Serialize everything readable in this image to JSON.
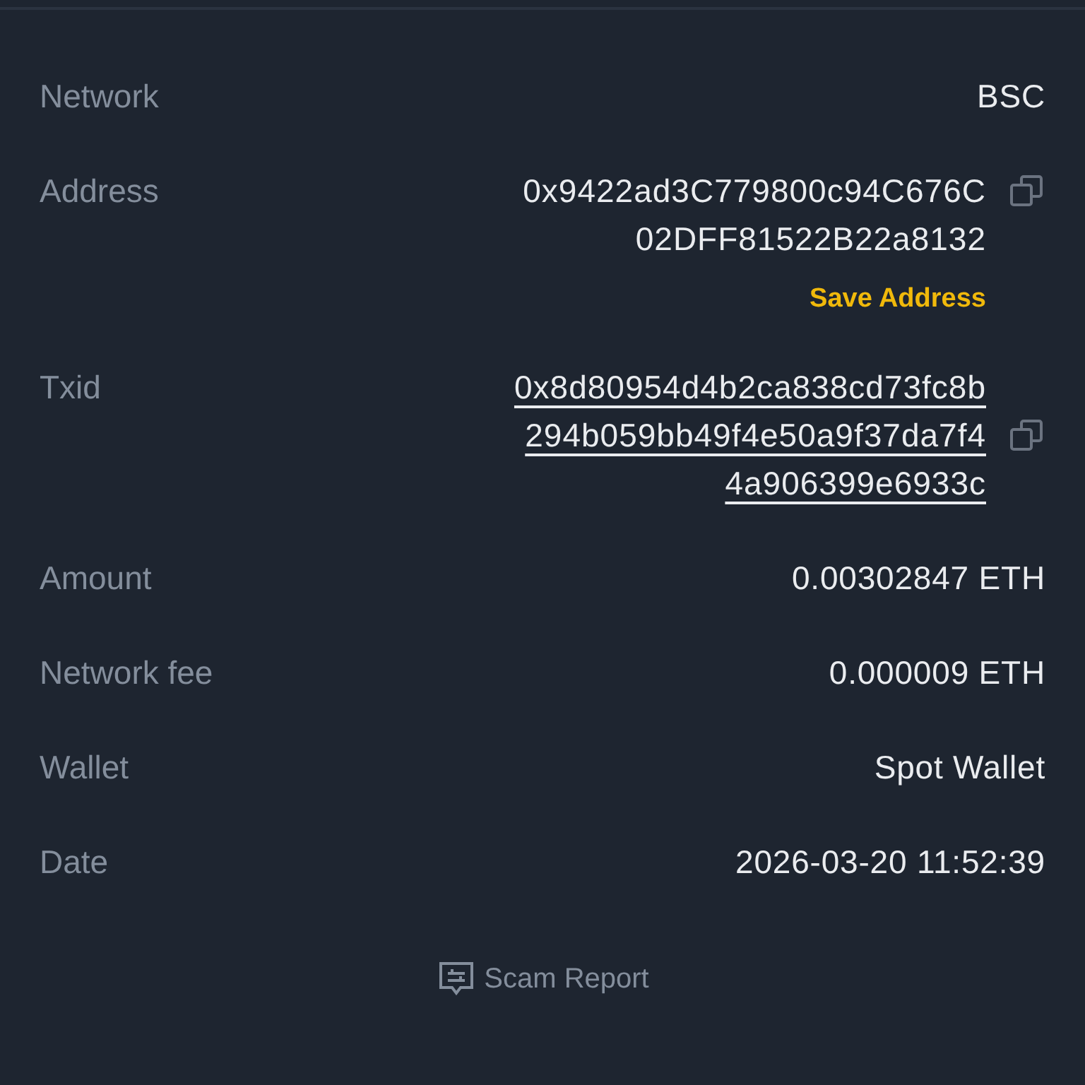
{
  "rows": [
    {
      "kind": "text",
      "label": "Network",
      "value": "BSC"
    },
    {
      "kind": "copy",
      "label": "Address",
      "lines": [
        "0x9422ad3C779800c94C676C",
        "02DFF81522B22a8132"
      ],
      "action": "Save Address"
    },
    {
      "kind": "link",
      "label": "Txid",
      "lines": [
        "0x8d80954d4b2ca838cd73fc8b",
        "294b059bb49f4e50a9f37da7f4",
        "4a906399e6933c"
      ]
    },
    {
      "kind": "text",
      "label": "Amount",
      "value": "0.00302847 ETH"
    },
    {
      "kind": "text",
      "label": "Network fee",
      "value": "0.000009 ETH"
    },
    {
      "kind": "text",
      "label": "Wallet",
      "value": "Spot Wallet"
    },
    {
      "kind": "text",
      "label": "Date",
      "value": "2026-03-20 11:52:39"
    }
  ],
  "footer": {
    "label": "Scam Report"
  }
}
